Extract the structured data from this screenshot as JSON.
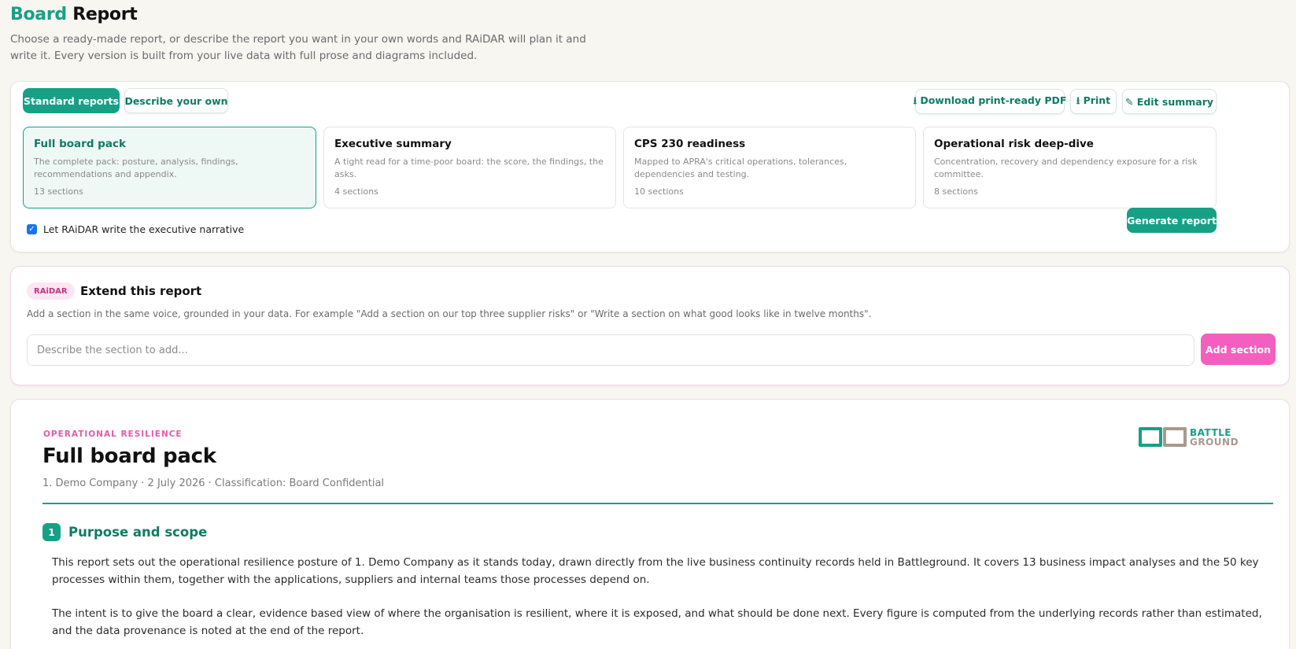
{
  "header": {
    "title_accent": "Board",
    "title_rest": "Report",
    "subtitle": "Choose a ready-made report, or describe the report you want in your own words and RAiDAR will plan it and write it. Every version is built from your live data with full prose and diagrams included."
  },
  "toolbar": {
    "standard_reports": "Standard reports",
    "describe_your_own": "Describe your own",
    "download_pdf": "⭳ Download print-ready PDF",
    "print": "⭳ Print",
    "edit_summary": "✎ Edit summary"
  },
  "templates": [
    {
      "title": "Full board pack",
      "desc": "The complete pack: posture, analysis, findings, recommendations and appendix.",
      "count": "13 sections",
      "selected": true
    },
    {
      "title": "Executive summary",
      "desc": "A tight read for a time-poor board: the score, the findings, the asks.",
      "count": "4 sections",
      "selected": false
    },
    {
      "title": "CPS 230 readiness",
      "desc": "Mapped to APRA's critical operations, tolerances, dependencies and testing.",
      "count": "10 sections",
      "selected": false
    },
    {
      "title": "Operational risk deep-dive",
      "desc": "Concentration, recovery and dependency exposure for a risk committee.",
      "count": "8 sections",
      "selected": false
    }
  ],
  "options": {
    "narrative_label": "Let RAiDAR write the executive narrative",
    "narrative_checked": true,
    "generate_label": "Generate report"
  },
  "extend": {
    "badge": "RAiDAR",
    "title": "Extend this report",
    "desc": "Add a section in the same voice, grounded in your data. For example \"Add a section on our top three supplier risks\" or \"Write a section on what good looks like in twelve months\".",
    "placeholder": "Describe the section to add...",
    "button": "Add section"
  },
  "report": {
    "eyebrow": "OPERATIONAL RESILIENCE",
    "title": "Full board pack",
    "meta": "1. Demo Company · 2 July 2026 · Classification: Board Confidential",
    "logo_line1": "BATTLE",
    "logo_line2": "GROUND",
    "section": {
      "number": "1",
      "title": "Purpose and scope",
      "paragraphs": [
        "This report sets out the operational resilience posture of 1. Demo Company as it stands today, drawn directly from the live business continuity records held in Battleground. It covers 13 business impact analyses and the 50 key processes within them, together with the applications, suppliers and internal teams those processes depend on.",
        "The intent is to give the board a clear, evidence based view of where the organisation is resilient, where it is exposed, and what should be done next. Every figure is computed from the underlying records rather than estimated, and the data provenance is noted at the end of the report."
      ]
    }
  },
  "colors": {
    "accent": "#17a085",
    "accent_dark": "#0e7b66",
    "pink": "#f35fbf",
    "eyebrow_pink": "#e55aa8",
    "background": "#f8f6f1"
  }
}
